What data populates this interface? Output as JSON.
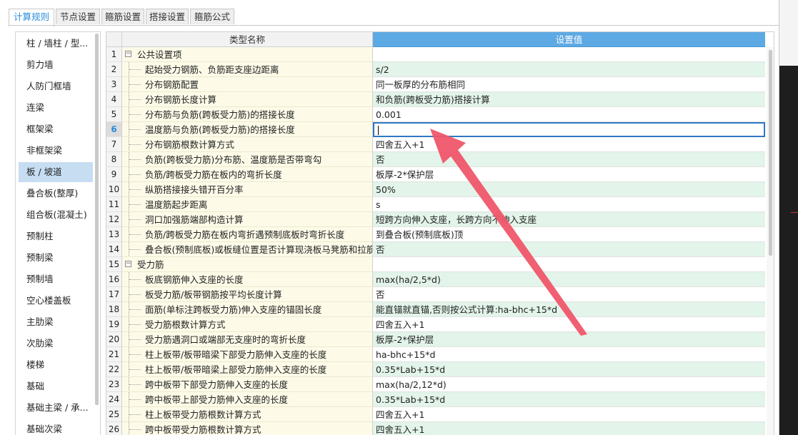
{
  "tabs": [
    {
      "label": "计算规则",
      "active": true
    },
    {
      "label": "节点设置",
      "active": false
    },
    {
      "label": "箍筋设置",
      "active": false
    },
    {
      "label": "搭接设置",
      "active": false
    },
    {
      "label": "箍筋公式",
      "active": false
    }
  ],
  "sidebar": {
    "items": [
      {
        "label": "柱 / 墙柱 / 型..."
      },
      {
        "label": "剪力墙"
      },
      {
        "label": "人防门框墙"
      },
      {
        "label": "连梁"
      },
      {
        "label": "框架梁"
      },
      {
        "label": "非框架梁"
      },
      {
        "label": "板 / 坡道",
        "selected": true
      },
      {
        "label": "叠合板(整厚)"
      },
      {
        "label": "组合板(混凝土)"
      },
      {
        "label": "预制柱"
      },
      {
        "label": "预制梁"
      },
      {
        "label": "预制墙"
      },
      {
        "label": "空心楼盖板"
      },
      {
        "label": "主肋梁"
      },
      {
        "label": "次肋梁"
      },
      {
        "label": "楼梯"
      },
      {
        "label": "基础"
      },
      {
        "label": "基础主梁 / 承..."
      },
      {
        "label": "基础次梁"
      }
    ]
  },
  "grid": {
    "header_name": "类型名称",
    "header_value": "设置值",
    "active_row": 6,
    "rows": [
      {
        "num": "1",
        "name": "公共设置项",
        "value": "",
        "group": true,
        "toggle": "−"
      },
      {
        "num": "2",
        "name": "起始受力钢筋、负筋距支座边距离",
        "value": "s/2"
      },
      {
        "num": "3",
        "name": "分布钢筋配置",
        "value": "同一板厚的分布筋相同"
      },
      {
        "num": "4",
        "name": "分布钢筋长度计算",
        "value": "和负筋(跨板受力筋)搭接计算"
      },
      {
        "num": "5",
        "name": "分布筋与负筋(跨板受力筋)的搭接长度",
        "value": "0.001"
      },
      {
        "num": "6",
        "name": "温度筋与负筋(跨板受力筋)的搭接长度",
        "value": "",
        "editing": true
      },
      {
        "num": "7",
        "name": "分布钢筋根数计算方式",
        "value": "四舍五入+1"
      },
      {
        "num": "8",
        "name": "负筋(跨板受力筋)分布筋、温度筋是否带弯勾",
        "value": "否"
      },
      {
        "num": "9",
        "name": "负筋/跨板受力筋在板内的弯折长度",
        "value": "板厚-2*保护层"
      },
      {
        "num": "10",
        "name": "纵筋搭接接头错开百分率",
        "value": "50%"
      },
      {
        "num": "11",
        "name": "温度筋起步距离",
        "value": "s"
      },
      {
        "num": "12",
        "name": "洞口加强筋端部构造计算",
        "value": "短跨方向伸入支座，长跨方向不伸入支座"
      },
      {
        "num": "13",
        "name": "负筋/跨板受力筋在板内弯折遇预制底板时弯折长度",
        "value": "到叠合板(预制底板)顶"
      },
      {
        "num": "14",
        "name": "叠合板(预制底板)或板缝位置是否计算现浇板马凳筋和拉筋",
        "value": "否"
      },
      {
        "num": "15",
        "name": "受力筋",
        "value": "",
        "group": true,
        "toggle": "−"
      },
      {
        "num": "16",
        "name": "板底钢筋伸入支座的长度",
        "value": "max(ha/2,5*d)"
      },
      {
        "num": "17",
        "name": "板受力筋/板带钢筋按平均长度计算",
        "value": "否"
      },
      {
        "num": "18",
        "name": "面筋(单标注跨板受力筋)伸入支座的锚固长度",
        "value": "能直锚就直锚,否则按公式计算:ha-bhc+15*d"
      },
      {
        "num": "19",
        "name": "受力筋根数计算方式",
        "value": "四舍五入+1"
      },
      {
        "num": "20",
        "name": "受力筋遇洞口或端部无支座时的弯折长度",
        "value": "板厚-2*保护层"
      },
      {
        "num": "21",
        "name": "柱上板带/板带暗梁下部受力筋伸入支座的长度",
        "value": "ha-bhc+15*d"
      },
      {
        "num": "22",
        "name": "柱上板带/板带暗梁上部受力筋伸入支座的长度",
        "value": "0.35*Lab+15*d"
      },
      {
        "num": "23",
        "name": "跨中板带下部受力筋伸入支座的长度",
        "value": "max(ha/2,12*d)"
      },
      {
        "num": "24",
        "name": "跨中板带上部受力筋伸入支座的长度",
        "value": "0.35*Lab+15*d"
      },
      {
        "num": "25",
        "name": "柱上板带受力筋根数计算方式",
        "value": "四舍五入+1"
      },
      {
        "num": "26",
        "name": "跨中板带受力筋根数计算方式",
        "value": "四舍五入+1"
      }
    ]
  },
  "colors": {
    "accent": "#2a8bd8",
    "header_value_bg": "#5da9e4",
    "value_green": "#e3f4ea",
    "name_bg": "#fdfbe8",
    "annotation_arrow": "#f0566a"
  }
}
